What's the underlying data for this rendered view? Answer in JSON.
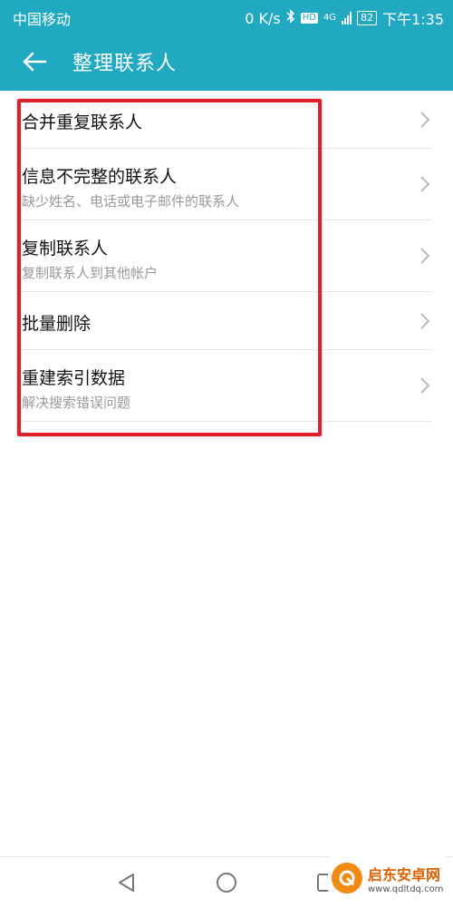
{
  "status_bar": {
    "carrier": "中国移动",
    "net_speed": "0 K/s",
    "bluetooth_icon": "bluetooth-icon",
    "hd_label": "HD",
    "network_label": "4G",
    "battery": "82",
    "time": "下午1:35"
  },
  "title_bar": {
    "back_icon": "arrow-left-icon",
    "title": "整理联系人"
  },
  "menu": {
    "items": [
      {
        "title": "合并重复联系人",
        "subtitle": ""
      },
      {
        "title": "信息不完整的联系人",
        "subtitle": "缺少姓名、电话或电子邮件的联系人"
      },
      {
        "title": "复制联系人",
        "subtitle": "复制联系人到其他帐户"
      },
      {
        "title": "批量删除",
        "subtitle": ""
      },
      {
        "title": "重建索引数据",
        "subtitle": "解决搜索错误问题"
      }
    ]
  },
  "nav_bar": {
    "back_icon": "triangle-back-icon",
    "home_icon": "circle-home-icon",
    "recents_icon": "square-recents-icon"
  },
  "watermark": {
    "title": "启东安卓网",
    "url": "www.qdltdq.com"
  },
  "colors": {
    "header_bg": "#20a9c1",
    "highlight_border": "#e0202a",
    "divider": "#e6e6e6",
    "subtitle_text": "#999999"
  }
}
